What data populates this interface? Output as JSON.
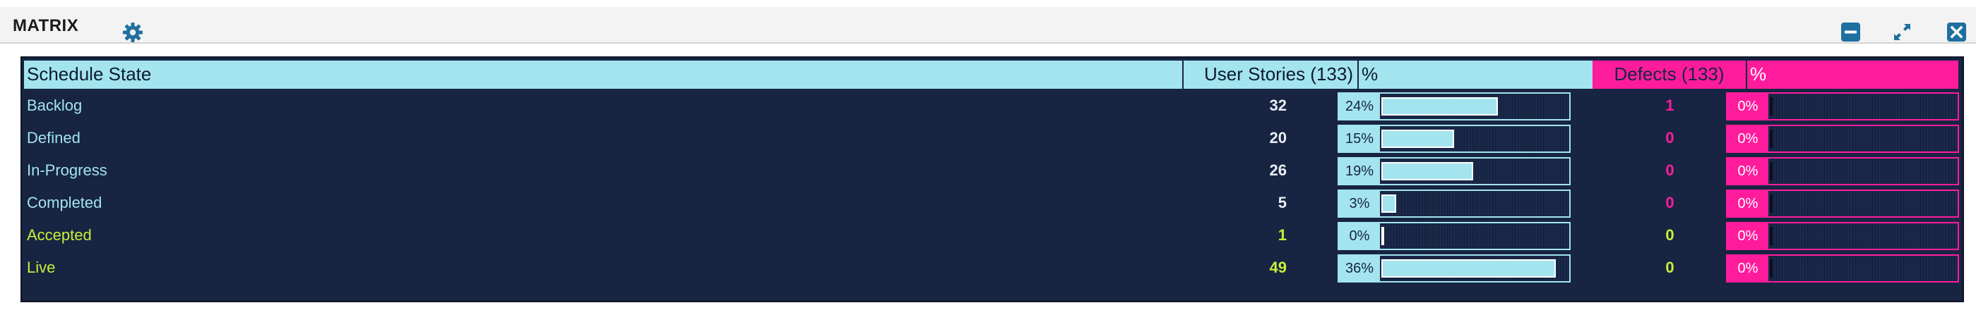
{
  "panel": {
    "title": "MATRIX",
    "icons": {
      "settings": "gear-icon",
      "minimize": "minimize-icon",
      "expand": "expand-icon",
      "close": "close-icon"
    },
    "colors": {
      "accent": "#1f6fa0",
      "matrix_background": "#172442",
      "stories_color": "#a3e4ee",
      "defects_color": "#ff1c9c",
      "accepted_color": "#c6f03a"
    }
  },
  "matrix": {
    "headers": {
      "state": "Schedule State",
      "stories": "User Stories (133)",
      "stories_pct": "%",
      "defects": "Defects (133)",
      "defects_pct": "%"
    },
    "rows": [
      {
        "state": "Backlog",
        "stories": "32",
        "stories_pct": "24%",
        "stories_fraction": 0.24,
        "defects": "1",
        "defects_pct": "0%",
        "defects_fraction": 0.0
      },
      {
        "state": "Defined",
        "stories": "20",
        "stories_pct": "15%",
        "stories_fraction": 0.15,
        "defects": "0",
        "defects_pct": "0%",
        "defects_fraction": 0.0
      },
      {
        "state": "In-Progress",
        "stories": "26",
        "stories_pct": "19%",
        "stories_fraction": 0.19,
        "defects": "0",
        "defects_pct": "0%",
        "defects_fraction": 0.0
      },
      {
        "state": "Completed",
        "stories": "5",
        "stories_pct": "3%",
        "stories_fraction": 0.03,
        "defects": "0",
        "defects_pct": "0%",
        "defects_fraction": 0.0
      },
      {
        "state": "Accepted",
        "stories": "1",
        "stories_pct": "0%",
        "stories_fraction": 0.0,
        "defects": "0",
        "defects_pct": "0%",
        "defects_fraction": 0.0
      },
      {
        "state": "Live",
        "stories": "49",
        "stories_pct": "36%",
        "stories_fraction": 0.36,
        "defects": "0",
        "defects_pct": "0%",
        "defects_fraction": 0.0
      }
    ]
  }
}
